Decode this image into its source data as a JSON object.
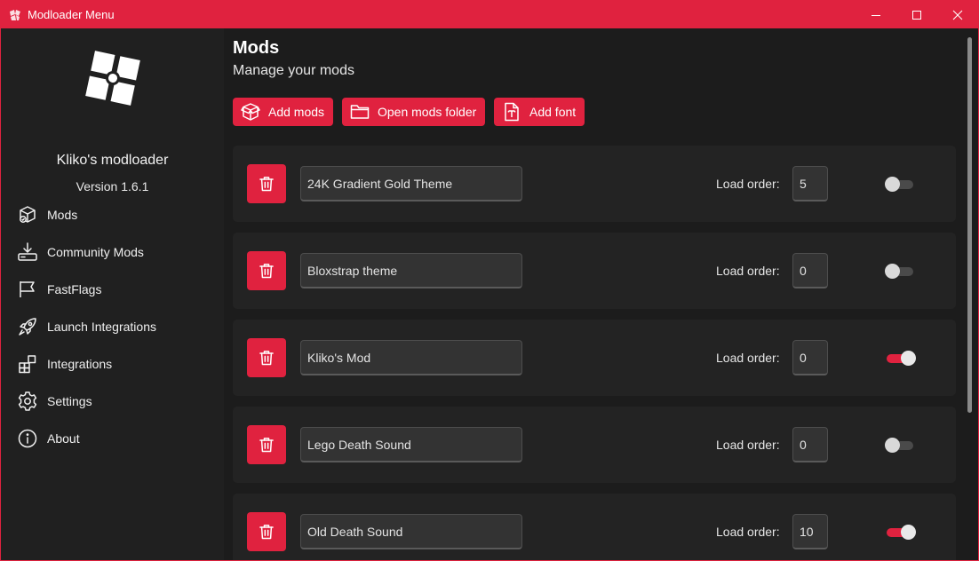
{
  "window": {
    "title": "Modloader Menu",
    "controls": [
      "minimize-icon",
      "maximize-icon",
      "close-icon"
    ],
    "accent_color": "#e0223f"
  },
  "sidebar": {
    "app_name": "Kliko's modloader",
    "version": "Version 1.6.1",
    "items": [
      {
        "label": "Mods",
        "icon": "mods-cube-icon"
      },
      {
        "label": "Community Mods",
        "icon": "download-icon"
      },
      {
        "label": "FastFlags",
        "icon": "flag-icon"
      },
      {
        "label": "Launch Integrations",
        "icon": "rocket-icon"
      },
      {
        "label": "Integrations",
        "icon": "apps-add-icon"
      },
      {
        "label": "Settings",
        "icon": "gear-icon"
      },
      {
        "label": "About",
        "icon": "info-icon"
      }
    ]
  },
  "main": {
    "title": "Mods",
    "subtitle": "Manage your mods",
    "actions": {
      "add_mods": "Add mods",
      "open_folder": "Open mods folder",
      "add_font": "Add font"
    },
    "load_order_label": "Load order:",
    "mods": [
      {
        "name": "24K Gradient Gold Theme",
        "load_order": "5",
        "enabled": false
      },
      {
        "name": "Bloxstrap theme",
        "load_order": "0",
        "enabled": false
      },
      {
        "name": "Kliko's Mod",
        "load_order": "0",
        "enabled": true
      },
      {
        "name": "Lego Death Sound",
        "load_order": "0",
        "enabled": false
      },
      {
        "name": "Old Death Sound",
        "load_order": "10",
        "enabled": true
      }
    ]
  }
}
